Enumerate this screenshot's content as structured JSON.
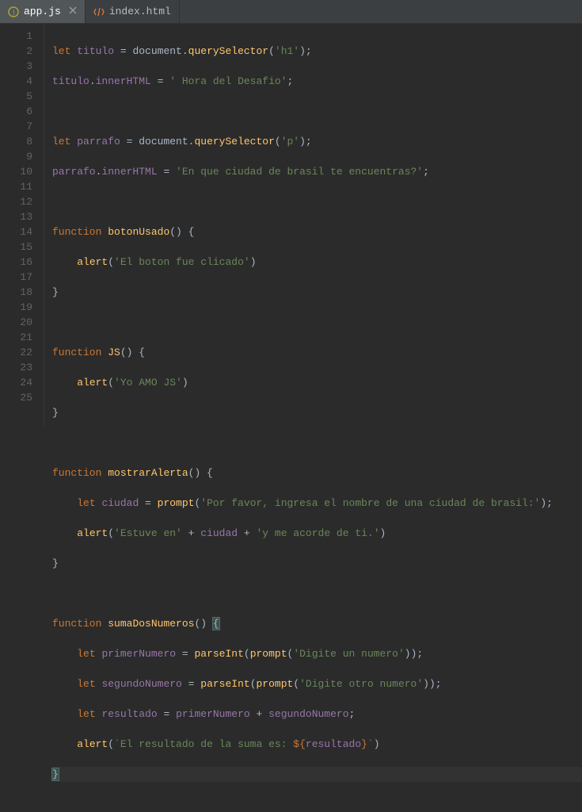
{
  "tabs": [
    {
      "label": "app.js",
      "active": true,
      "icon": "js"
    },
    {
      "label": "index.html",
      "active": false,
      "icon": "html"
    }
  ],
  "lineNumbers": [
    "1",
    "2",
    "3",
    "4",
    "5",
    "6",
    "7",
    "8",
    "9",
    "10",
    "11",
    "12",
    "13",
    "14",
    "15",
    "16",
    "17",
    "18",
    "19",
    "20",
    "21",
    "22",
    "23",
    "24",
    "25"
  ],
  "code": {
    "l1": {
      "kw": "let",
      "var": "titulo",
      "op1": " = ",
      "obj": "document",
      "dot": ".",
      "fn": "querySelector",
      "p1": "(",
      "str": "'h1'",
      "p2": ");"
    },
    "l2": {
      "var": "titulo",
      "dot": ".",
      "prop": "innerHTML",
      "op": " = ",
      "str": "' Hora del Desafio'",
      "semi": ";"
    },
    "l4": {
      "kw": "let",
      "var": "parrafo",
      "op1": " = ",
      "obj": "document",
      "dot": ".",
      "fn": "querySelector",
      "p1": "(",
      "str": "'p'",
      "p2": ");"
    },
    "l5": {
      "var": "parrafo",
      "dot": ".",
      "prop": "innerHTML",
      "op": " = ",
      "str": "'En que ciudad de brasil te encuentras?'",
      "semi": ";"
    },
    "l7": {
      "kw": "function",
      "fn": "botonUsado",
      "rest": "() {"
    },
    "l8": {
      "indent": "    ",
      "fn": "alert",
      "p1": "(",
      "str": "'El boton fue clicado'",
      "p2": ")"
    },
    "l9": {
      "brace": "}"
    },
    "l11": {
      "kw": "function",
      "fn": "JS",
      "rest": "() {"
    },
    "l12": {
      "indent": "    ",
      "fn": "alert",
      "p1": "(",
      "str": "'Yo AMO JS'",
      "p2": ")"
    },
    "l13": {
      "brace": "}"
    },
    "l15": {
      "kw": "function",
      "fn": "mostrarAlerta",
      "rest": "() {"
    },
    "l16": {
      "indent": "    ",
      "kw": "let",
      "var": "ciudad",
      "op": " = ",
      "fn": "prompt",
      "p1": "(",
      "str": "'Por favor, ingresa el nombre de una ciudad de brasil:'",
      "p2": ");"
    },
    "l17": {
      "indent": "    ",
      "fn": "alert",
      "p1": "(",
      "str1": "'Estuve en'",
      "op1": " + ",
      "var": "ciudad",
      "op2": " + ",
      "str2": "'y me acorde de ti.'",
      "p2": ")"
    },
    "l18": {
      "brace": "}"
    },
    "l20": {
      "kw": "function",
      "fn": "sumaDosNumeros",
      "rest": "() ",
      "brace": "{"
    },
    "l21": {
      "indent": "    ",
      "kw": "let",
      "var": "primerNumero",
      "op": " = ",
      "fn1": "parseInt",
      "p1": "(",
      "fn2": "prompt",
      "p2": "(",
      "str": "'Digite un numero'",
      "p3": "));"
    },
    "l22": {
      "indent": "    ",
      "kw": "let",
      "var": "segundoNumero",
      "op": " = ",
      "fn1": "parseInt",
      "p1": "(",
      "fn2": "prompt",
      "p2": "(",
      "str": "'Digite otro numero'",
      "p3": "));"
    },
    "l23": {
      "indent": "    ",
      "kw": "let",
      "var": "resultado",
      "op": " = ",
      "var2": "primerNumero",
      "plus": " + ",
      "var3": "segundoNumero",
      "semi": ";"
    },
    "l24": {
      "indent": "    ",
      "fn": "alert",
      "p1": "(",
      "tpl1": "`El resultado de la suma es: ",
      "sub1": "${",
      "var": "resultado",
      "sub2": "}",
      "tpl2": "`",
      "p2": ")"
    },
    "l25": {
      "brace": "}"
    }
  }
}
